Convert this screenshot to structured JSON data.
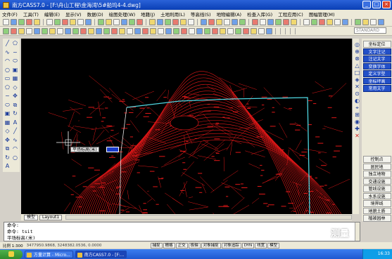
{
  "window": {
    "title": "南方CASS7.0 - [F:\\舟山工程\\金海湾\\5#船坞4-4.dwg]"
  },
  "menu": [
    "文件(F)",
    "工具(T)",
    "编辑(E)",
    "显示(V)",
    "数据(D)",
    "绘图处理(W)",
    "地籍(J)",
    "土地利用(L)",
    "等高线(S)",
    "地物编辑(A)",
    "检查入库(G)",
    "工程应用(C)",
    "图幅管理(M)"
  ],
  "toolbar": {
    "layer_standard": "STANDARD"
  },
  "left_tools": [
    "line-icon",
    "polyline-icon",
    "arc-icon",
    "circle-icon",
    "rect-icon",
    "polygon-icon",
    "spline-icon",
    "ellipse-icon",
    "block-icon",
    "hatch-icon",
    "region-icon",
    "move-icon",
    "copy-icon",
    "rotate-icon",
    "text-icon"
  ],
  "right_panel": {
    "top_buttons": [
      "坐标定位",
      "文字注记",
      "注记文字",
      "变换字体",
      "定义字型",
      "坐标坪高",
      "常用文字"
    ],
    "bottom_buttons": [
      "控制点",
      "居民地",
      "独立地物",
      "交通设施",
      "管线设施",
      "水系设施",
      "境界线",
      "地貌土质",
      "植被园林"
    ]
  },
  "tabs": [
    "模型",
    "Layout1"
  ],
  "canvas": {
    "tooltip": "平场标高(米)",
    "input_value": ""
  },
  "command": {
    "lines": [
      "命令:",
      "命令: tsit",
      "平场标高(米)"
    ]
  },
  "status": {
    "scale": "比例 1:300",
    "coords": "3477950.9868, 3248382.0536, 0.0000",
    "toggles": [
      "捕捉",
      "栅格",
      "正交",
      "极轴",
      "对象捕捉",
      "对象追踪",
      "DYN",
      "线宽",
      "模型"
    ]
  },
  "taskbar": {
    "items": [
      "方量计算 - Micro...",
      "南方CASS7.0 - [F:..."
    ],
    "clock": "16:33"
  },
  "watermark": "测量",
  "colors": {
    "contour": "#e01818",
    "boundary": "#4fd6e0",
    "canvas": "#000000"
  }
}
